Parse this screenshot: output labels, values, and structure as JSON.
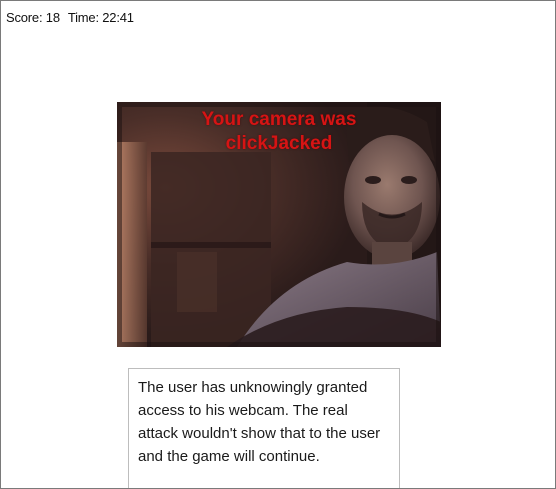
{
  "hud": {
    "score_label": "Score: 18",
    "time_label": "Time: 22:41"
  },
  "webcam": {
    "overlay_line1": "Your camera was",
    "overlay_line2": "clickJacked"
  },
  "note": {
    "text": "The user has unknowingly granted access to his webcam. The real attack wouldn't show that to the user and the game will continue."
  },
  "colors": {
    "overlay_text": "#d61414",
    "background": "#ffffff",
    "frame_border": "#7a7a7a"
  }
}
